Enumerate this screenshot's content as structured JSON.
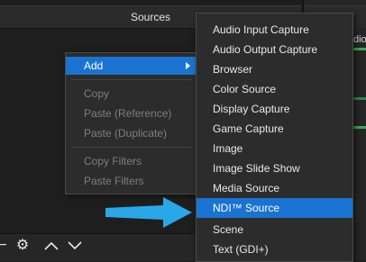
{
  "sources": {
    "title": "Sources"
  },
  "audio_mixer": {
    "partial_label": "dio"
  },
  "toolbar": {
    "items": [
      {
        "icon": "minus-icon",
        "glyph": "−"
      },
      {
        "icon": "gear-icon",
        "glyph": "⚙"
      },
      {
        "icon": "chevron-up-icon",
        "glyph": "︿"
      },
      {
        "icon": "chevron-down-icon",
        "glyph": "﹀"
      }
    ]
  },
  "context_menu": {
    "add": "Add",
    "copy": "Copy",
    "paste_reference": "Paste (Reference)",
    "paste_duplicate": "Paste (Duplicate)",
    "copy_filters": "Copy Filters",
    "paste_filters": "Paste Filters"
  },
  "add_submenu": {
    "items": [
      "Audio Input Capture",
      "Audio Output Capture",
      "Browser",
      "Color Source",
      "Display Capture",
      "Game Capture",
      "Image",
      "Image Slide Show",
      "Media Source",
      "NDI™ Source",
      "Scene",
      "Text (GDI+)"
    ],
    "highlighted": "NDI™ Source"
  },
  "colors": {
    "highlight": "#1a73d1",
    "annotation_arrow": "#29a8e8"
  }
}
